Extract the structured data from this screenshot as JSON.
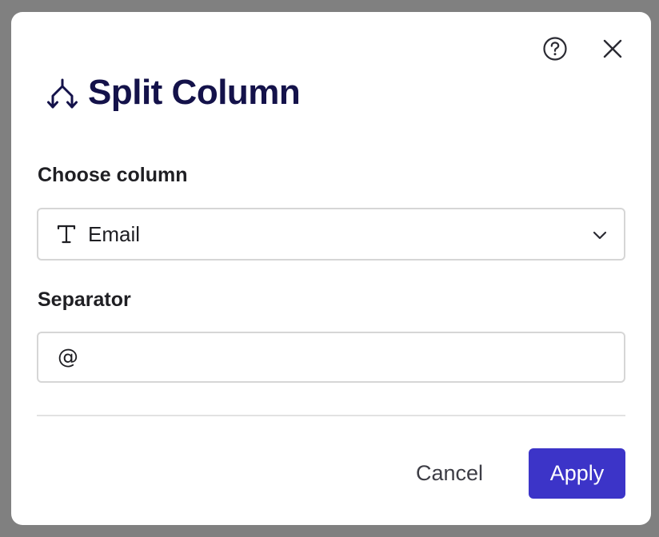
{
  "dialog": {
    "title": "Split Column",
    "title_icon": "split-arrows-icon",
    "help_icon": "help-circle-icon",
    "close_icon": "close-icon"
  },
  "column_field": {
    "label": "Choose column",
    "selected_value": "Email",
    "type_icon": "text-type-icon",
    "dropdown_icon": "chevron-down-icon"
  },
  "separator_field": {
    "label": "Separator",
    "value": "@"
  },
  "footer": {
    "cancel_label": "Cancel",
    "apply_label": "Apply"
  },
  "colors": {
    "title": "#14124a",
    "primary_button": "#3c34c8",
    "overlay": "#808080",
    "border": "#d6d6d6"
  }
}
